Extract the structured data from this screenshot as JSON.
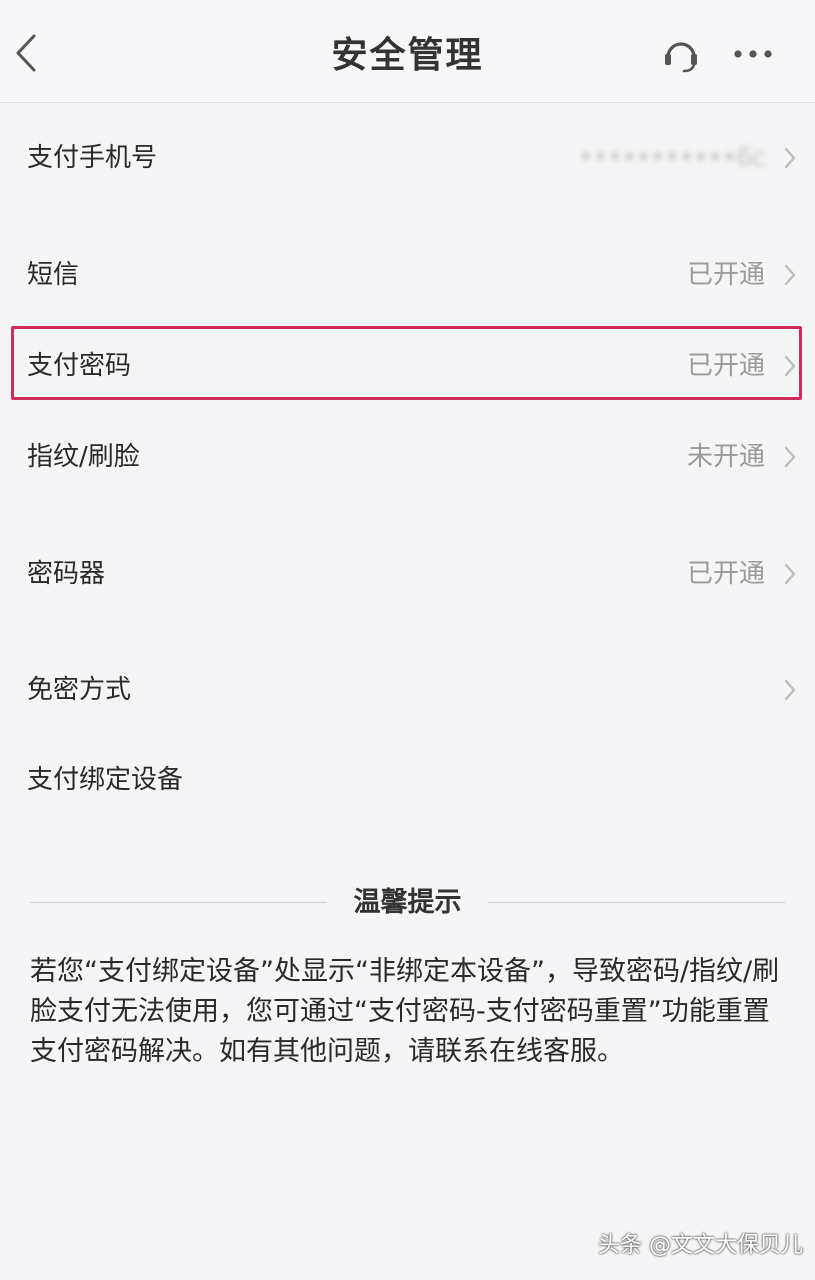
{
  "header": {
    "title": "安全管理"
  },
  "rows": [
    {
      "label": "支付手机号",
      "value": "•••••••••••6c"
    },
    {
      "label": "短信",
      "value": "已开通"
    },
    {
      "label": "支付密码",
      "value": "已开通"
    },
    {
      "label": "指纹/刷脸",
      "value": "未开通"
    },
    {
      "label": "密码器",
      "value": "已开通"
    },
    {
      "label": "免密方式",
      "value": ""
    },
    {
      "label": "支付绑定设备",
      "value": ""
    }
  ],
  "tips": {
    "title": "温馨提示",
    "body": "若您“支付绑定设备”处显示“非绑定本设备”，导致密码/指纹/刷脸支付无法使用，您可通过“支付密码-支付密码重置”功能重置支付密码解决。如有其他问题，请联系在线客服。"
  },
  "watermark": "头条 @文文大保贝儿",
  "colors": {
    "highlight": "#cf2e5a",
    "background": "#f5f5f7",
    "value_text": "#9a9a9a"
  },
  "icons": {
    "back": "chevron-left-icon",
    "service": "headset-icon",
    "more": "more-dots-icon",
    "row_arrow": "chevron-right-icon"
  }
}
